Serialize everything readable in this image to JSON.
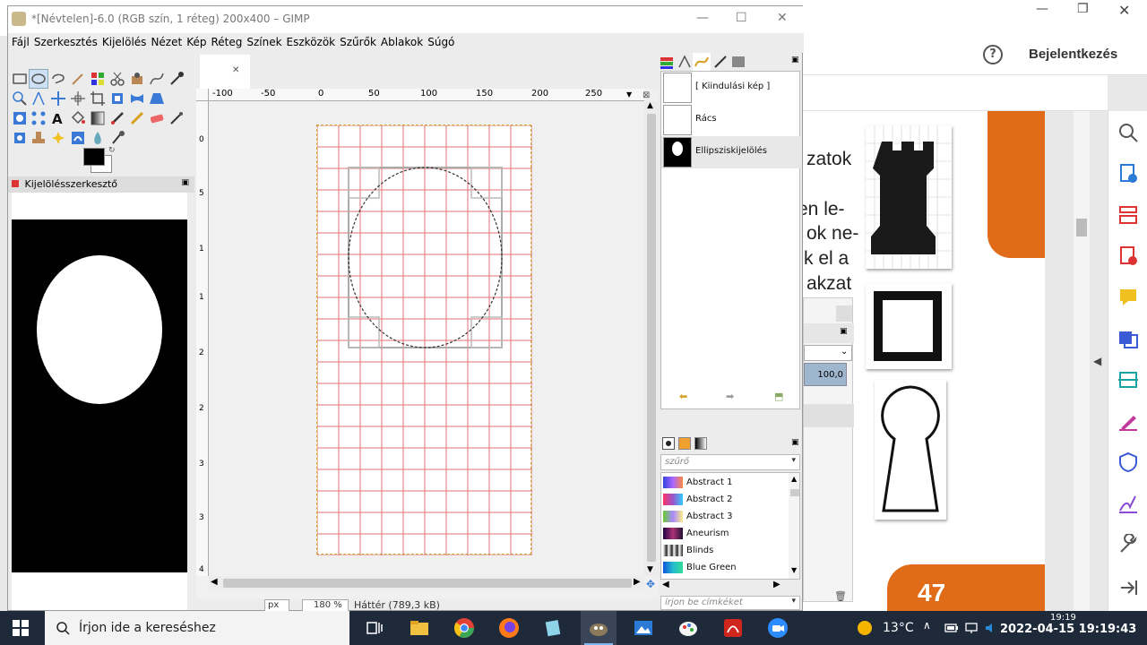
{
  "pdf_viewer": {
    "login_label": "Bejelentkezés",
    "page_number": "47",
    "text_lines": [
      "zatok",
      "en le-",
      "ok ne-",
      "k el a",
      "akzat"
    ],
    "dialog_value": "100,0"
  },
  "gimp": {
    "title": "*[Névtelen]-6.0 (RGB szín, 1 réteg) 200x400 – GIMP",
    "menu": [
      "Fájl",
      "Szerkesztés",
      "Kijelölés",
      "Nézet",
      "Kép",
      "Réteg",
      "Színek",
      "Eszközök",
      "Szűrők",
      "Ablakok",
      "Súgó"
    ],
    "selection_editor_tab": "Kijelölésszerkesztő",
    "ruler_h_labels": [
      "-100",
      "-50",
      "0",
      "50",
      "100",
      "150",
      "200",
      "250"
    ],
    "ruler_v_labels": [
      "0",
      "5",
      "1",
      "1",
      "2",
      "2",
      "3",
      "3",
      "4"
    ],
    "status": {
      "unit": "px",
      "zoom": "180 %",
      "layer_info": "Háttér (789,3 kB)"
    },
    "layers": [
      {
        "name": "[ Kiindulási kép ]"
      },
      {
        "name": "Rács"
      },
      {
        "name": "Ellipsziskijelölés"
      }
    ],
    "gradient_filter_placeholder": "szűrő",
    "gradients": [
      {
        "name": "Abstract 1",
        "colors": [
          "#3344dd",
          "#aa66ff",
          "#ff8844"
        ]
      },
      {
        "name": "Abstract 2",
        "colors": [
          "#ff3366",
          "#9955cc",
          "#33ccff"
        ]
      },
      {
        "name": "Abstract 3",
        "colors": [
          "#66cc33",
          "#aa88ff",
          "#ffee88"
        ]
      },
      {
        "name": "Aneurism",
        "colors": [
          "#220044",
          "#aa3377",
          "#221133"
        ]
      },
      {
        "name": "Blinds",
        "colors": [
          "#ffffff",
          "#222222",
          "#ffffff"
        ]
      },
      {
        "name": "Blue Green",
        "colors": [
          "#1155dd",
          "#22bbcc",
          "#33dd99"
        ]
      }
    ],
    "tag_placeholder": "írjon be címkéket"
  },
  "taskbar": {
    "search_placeholder": "Írjon ide a kereséshez",
    "temperature": "13°C",
    "time_small": "19:19",
    "datetime": "2022-04-15  19:19:43"
  },
  "colors": {
    "orange": "#e06c1a",
    "grid_red": "#e07070",
    "taskbar": "#1e2a3a"
  }
}
